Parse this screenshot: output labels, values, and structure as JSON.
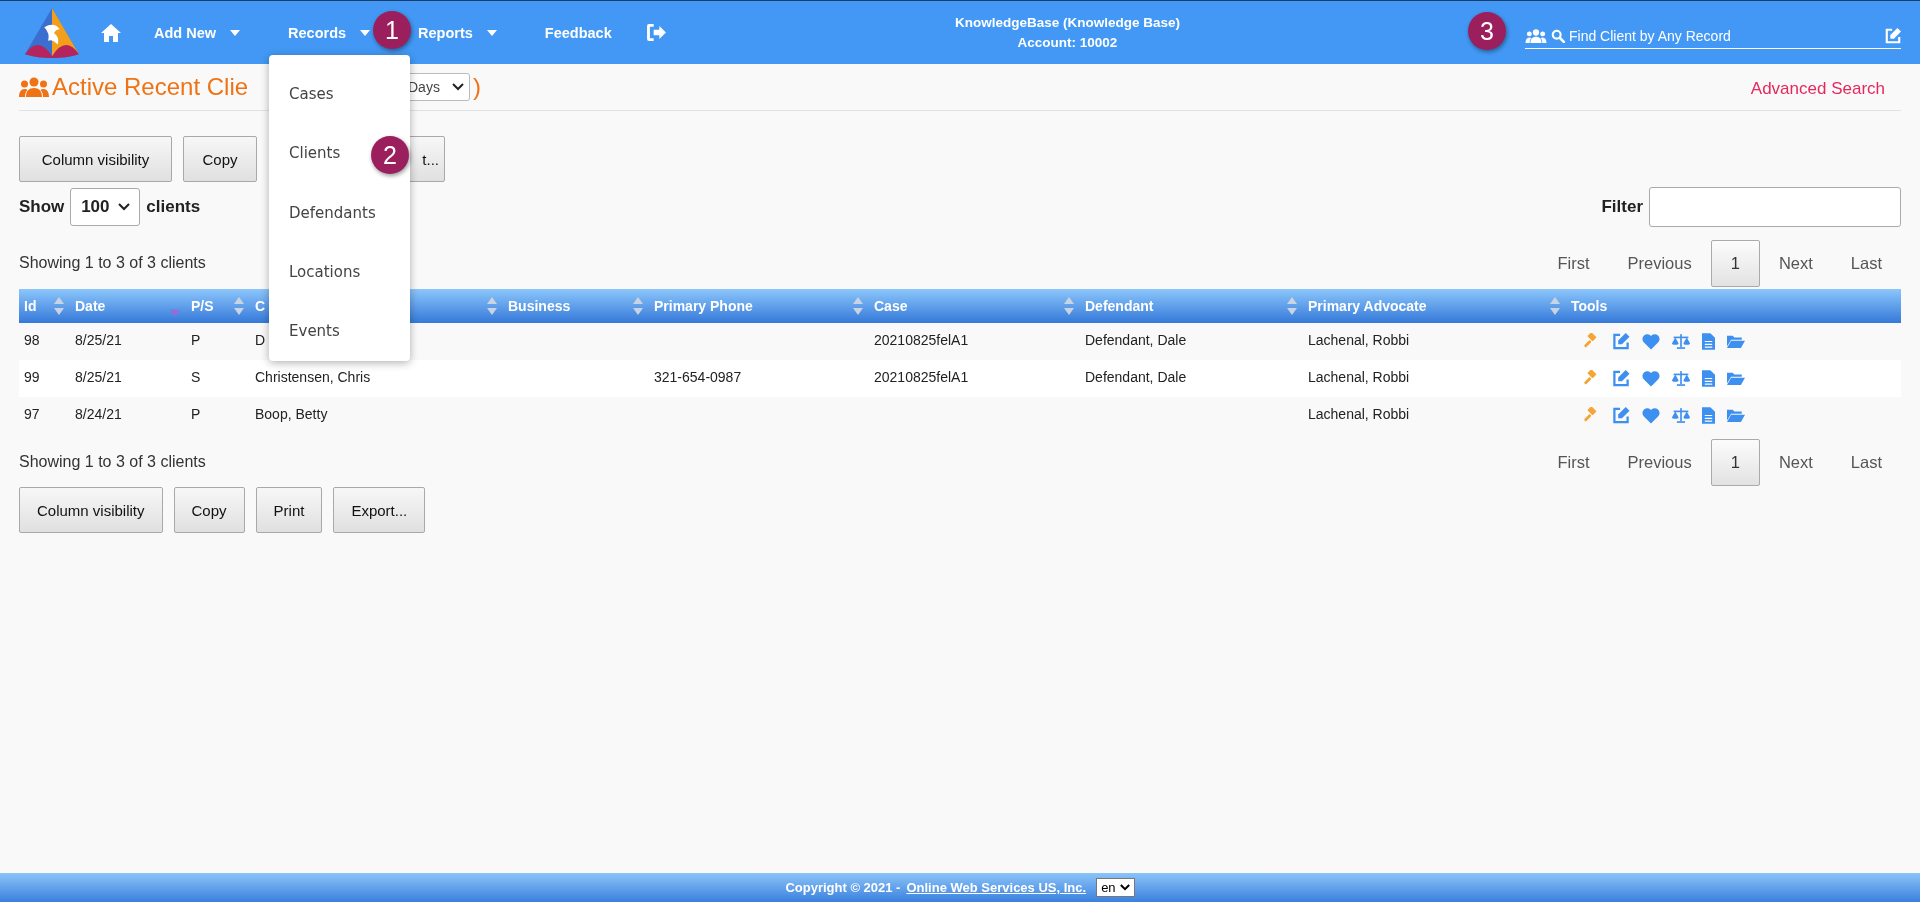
{
  "nav": {
    "items": [
      {
        "kind": "home"
      },
      {
        "kind": "menu",
        "label": "Add New"
      },
      {
        "kind": "menu",
        "label": "Records",
        "menu": {
          "items": [
            "Cases",
            "Clients",
            "Defendants",
            "Locations",
            "Events"
          ]
        }
      },
      {
        "kind": "menu",
        "label": "Reports"
      },
      {
        "kind": "link",
        "label": "Feedback"
      },
      {
        "kind": "logout"
      }
    ]
  },
  "account": {
    "name": "KnowledgeBase (Knowledge Base)",
    "number": "Account: 10002"
  },
  "search": {
    "placeholder": "Find Client by Any Record"
  },
  "callouts": [
    {
      "number": "1"
    },
    {
      "number": "2"
    },
    {
      "number": "3"
    }
  ],
  "page_title": {
    "text": "Active Recent Clie",
    "period": "Days",
    "close": ")"
  },
  "advanced_search": "Advanced Search",
  "top_buttons": [
    {
      "label": "Column visibility",
      "kind": "full"
    },
    {
      "label": "Copy",
      "kind": "full"
    },
    {
      "label": "t...",
      "kind": "clipped"
    }
  ],
  "length": {
    "prefix": "Show",
    "value": "100",
    "suffix": "clients"
  },
  "filter": {
    "label": "Filter"
  },
  "info_top": "Showing 1 to 3 of 3 clients",
  "pagination_top": [
    {
      "label": "First",
      "selected": false
    },
    {
      "label": "Previous",
      "selected": false
    },
    {
      "label": "1",
      "selected": true
    },
    {
      "label": "Next",
      "selected": false
    },
    {
      "label": "Last",
      "selected": false
    }
  ],
  "table": {
    "columns": [
      {
        "label": "Id",
        "sorted": false
      },
      {
        "label": "Date",
        "sorted": true
      },
      {
        "label": "P/S",
        "sorted": false
      },
      {
        "label": "C",
        "sorted": false
      },
      {
        "label": "Business",
        "sorted": false
      },
      {
        "label": "Primary Phone",
        "sorted": false
      },
      {
        "label": "Case",
        "sorted": false
      },
      {
        "label": "Defendant",
        "sorted": false
      },
      {
        "label": "Primary Advocate",
        "sorted": false
      },
      {
        "label": "Tools"
      }
    ],
    "rows": [
      {
        "cells": [
          "98",
          "8/25/21",
          "P",
          "D",
          null,
          null,
          "20210825felA1",
          "Defendant, Dale",
          "Lachenal, Robbi"
        ]
      },
      {
        "cells": [
          "99",
          "8/25/21",
          "S",
          "Christensen, Chris",
          null,
          "321-654-0987",
          "20210825felA1",
          "Defendant, Dale",
          "Lachenal, Robbi"
        ]
      },
      {
        "cells": [
          "97",
          "8/24/21",
          "P",
          "Boop, Betty",
          null,
          null,
          null,
          null,
          "Lachenal, Robbi"
        ]
      }
    ]
  },
  "info_bottom": "Showing 1 to 3 of 3 clients",
  "pagination_bottom": [
    {
      "label": "First",
      "selected": false
    },
    {
      "label": "Previous",
      "selected": false
    },
    {
      "label": "1",
      "selected": true
    },
    {
      "label": "Next",
      "selected": false
    },
    {
      "label": "Last",
      "selected": false
    }
  ],
  "bottom_buttons": [
    {
      "label": "Column visibility",
      "kind": "full"
    },
    {
      "label": "Copy",
      "kind": "full"
    },
    {
      "label": "Print",
      "kind": "full"
    },
    {
      "label": "Export...",
      "kind": "full"
    }
  ],
  "footer": {
    "copyright": "Copyright © 2021 -",
    "link": "Online Web Services US, Inc.",
    "language": "en"
  }
}
